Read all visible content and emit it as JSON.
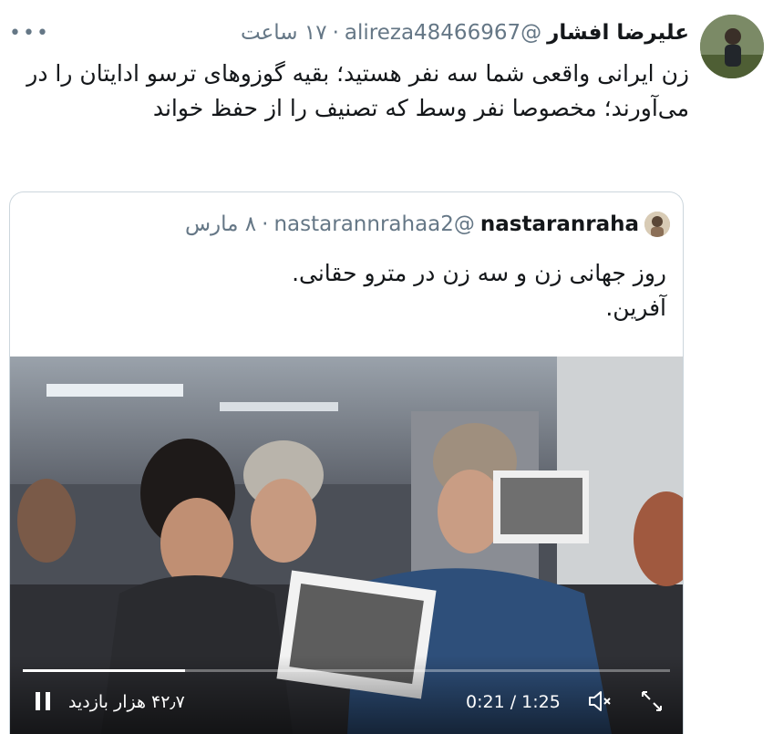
{
  "tweet": {
    "display_name": "علیرضا افشار",
    "handle": "@alireza48466967",
    "separator": "·",
    "time": "۱۷ ساعت",
    "more_icon": "•••",
    "text": "زن ایرانی واقعی شما سه نفر هستید؛ بقیه گوزوهای ترسو ادایتان را در می‌آورند؛ مخصوصا نفر وسط که تصنیف را از حفظ خواند"
  },
  "quoted": {
    "display_name": "nastaranraha",
    "handle": "@nastarannrahaa2",
    "separator": "·",
    "time": "۸ مارس",
    "text_line1": "روز جهانی زن و سه زن در مترو حقانی.",
    "text_line2": "آفرین."
  },
  "video": {
    "views": "۴۲٫۷ هزار بازدید",
    "timecode": "0:21 / 1:25",
    "progress": 0.25
  },
  "icons": {
    "more": "more-horizontal-icon",
    "play_pause": "pause-icon",
    "volume": "volume-muted-icon",
    "fullscreen": "expand-icon"
  }
}
